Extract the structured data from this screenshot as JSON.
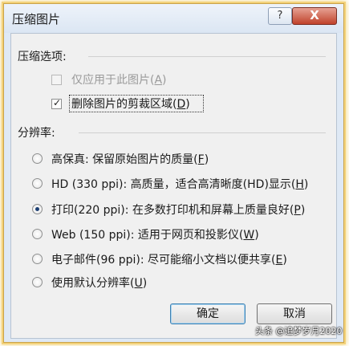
{
  "window": {
    "title": "压缩图片",
    "help_label": "?",
    "close_label": "X"
  },
  "compress_options": {
    "label": "压缩选项:",
    "only_this": {
      "text": "仅应用于此图片(",
      "key": "A",
      "tail": ")",
      "checked": false,
      "enabled": false
    },
    "delete_cropped": {
      "text": "删除图片的剪裁区域(",
      "key": "D",
      "tail": ")",
      "checked": true,
      "enabled": true
    }
  },
  "resolution": {
    "label": "分辨率:",
    "selected": "print",
    "options": [
      {
        "id": "hifi",
        "text": "高保真: 保留原始图片的质量(",
        "key": "F",
        "tail": ")"
      },
      {
        "id": "hd",
        "text": "HD (330 ppi): 高质量，适合高清晰度(HD)显示(",
        "key": "H",
        "tail": ")"
      },
      {
        "id": "print",
        "text": "打印(220 ppi): 在多数打印机和屏幕上质量良好(",
        "key": "P",
        "tail": ")"
      },
      {
        "id": "web",
        "text": "Web (150 ppi): 适用于网页和投影仪(",
        "key": "W",
        "tail": ")"
      },
      {
        "id": "email",
        "text": "电子邮件(96 ppi): 尽可能缩小文档以便共享(",
        "key": "E",
        "tail": ")"
      },
      {
        "id": "default",
        "text": "使用默认分辨率(",
        "key": "U",
        "tail": ")"
      }
    ]
  },
  "buttons": {
    "ok": "确定",
    "cancel": "取消"
  },
  "watermark": "头条 @追梦岁月2020"
}
